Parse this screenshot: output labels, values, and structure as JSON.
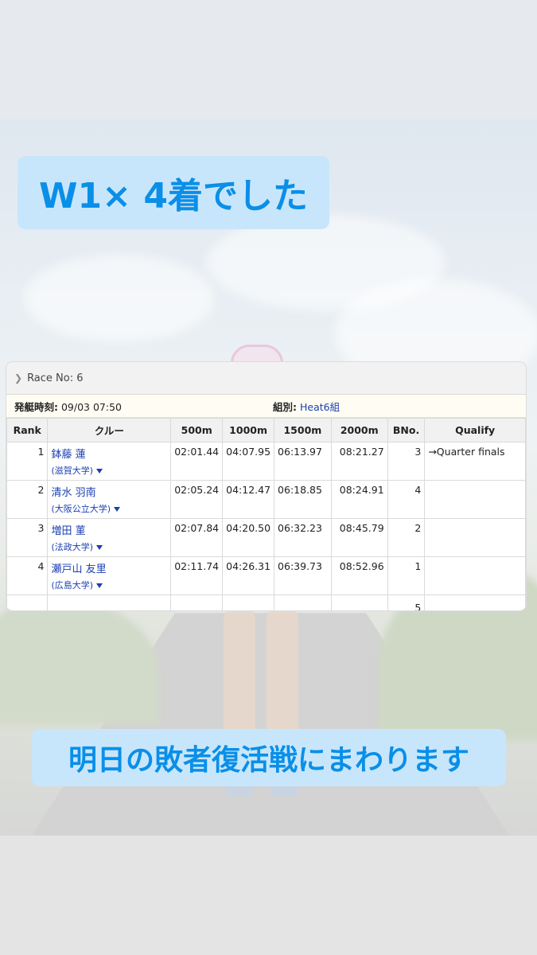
{
  "banners": {
    "top": "W1× 4着でした",
    "bottom": "明日の敗者復活戦にまわります"
  },
  "race": {
    "header": "Race No: 6",
    "start_label": "発艇時刻:",
    "start_value": "09/03 07:50",
    "group_label": "組別:",
    "group_value": "Heat6組"
  },
  "table": {
    "columns": [
      "Rank",
      "クルー",
      "500m",
      "1000m",
      "1500m",
      "2000m",
      "BNo.",
      "Qualify"
    ],
    "rows": [
      {
        "rank": "1",
        "name": "鉢藤 蓮",
        "univ": "(滋賀大学)",
        "t500": "02:01.44",
        "t1000": "04:07.95",
        "t1500": "06:13.97",
        "t2000": "08:21.27",
        "bno": "3",
        "qualify": "→Quarter finals"
      },
      {
        "rank": "2",
        "name": "清水 羽南",
        "univ": "(大阪公立大学)",
        "t500": "02:05.24",
        "t1000": "04:12.47",
        "t1500": "06:18.85",
        "t2000": "08:24.91",
        "bno": "4",
        "qualify": ""
      },
      {
        "rank": "3",
        "name": "増田 菫",
        "univ": "(法政大学)",
        "t500": "02:07.84",
        "t1000": "04:20.50",
        "t1500": "06:32.23",
        "t2000": "08:45.79",
        "bno": "2",
        "qualify": ""
      },
      {
        "rank": "4",
        "name": "瀬戸山 友里",
        "univ": "(広島大学)",
        "t500": "02:11.74",
        "t1000": "04:26.31",
        "t1500": "06:39.73",
        "t2000": "08:52.96",
        "bno": "1",
        "qualify": ""
      },
      {
        "rank": "",
        "name": "",
        "univ": "",
        "t500": "",
        "t1000": "",
        "t1500": "",
        "t2000": "",
        "bno": "5",
        "qualify": ""
      }
    ]
  },
  "colors": {
    "banner_bg": "#c8e6fb",
    "banner_text": "#0a8fe8",
    "link": "#1a3fb0"
  }
}
